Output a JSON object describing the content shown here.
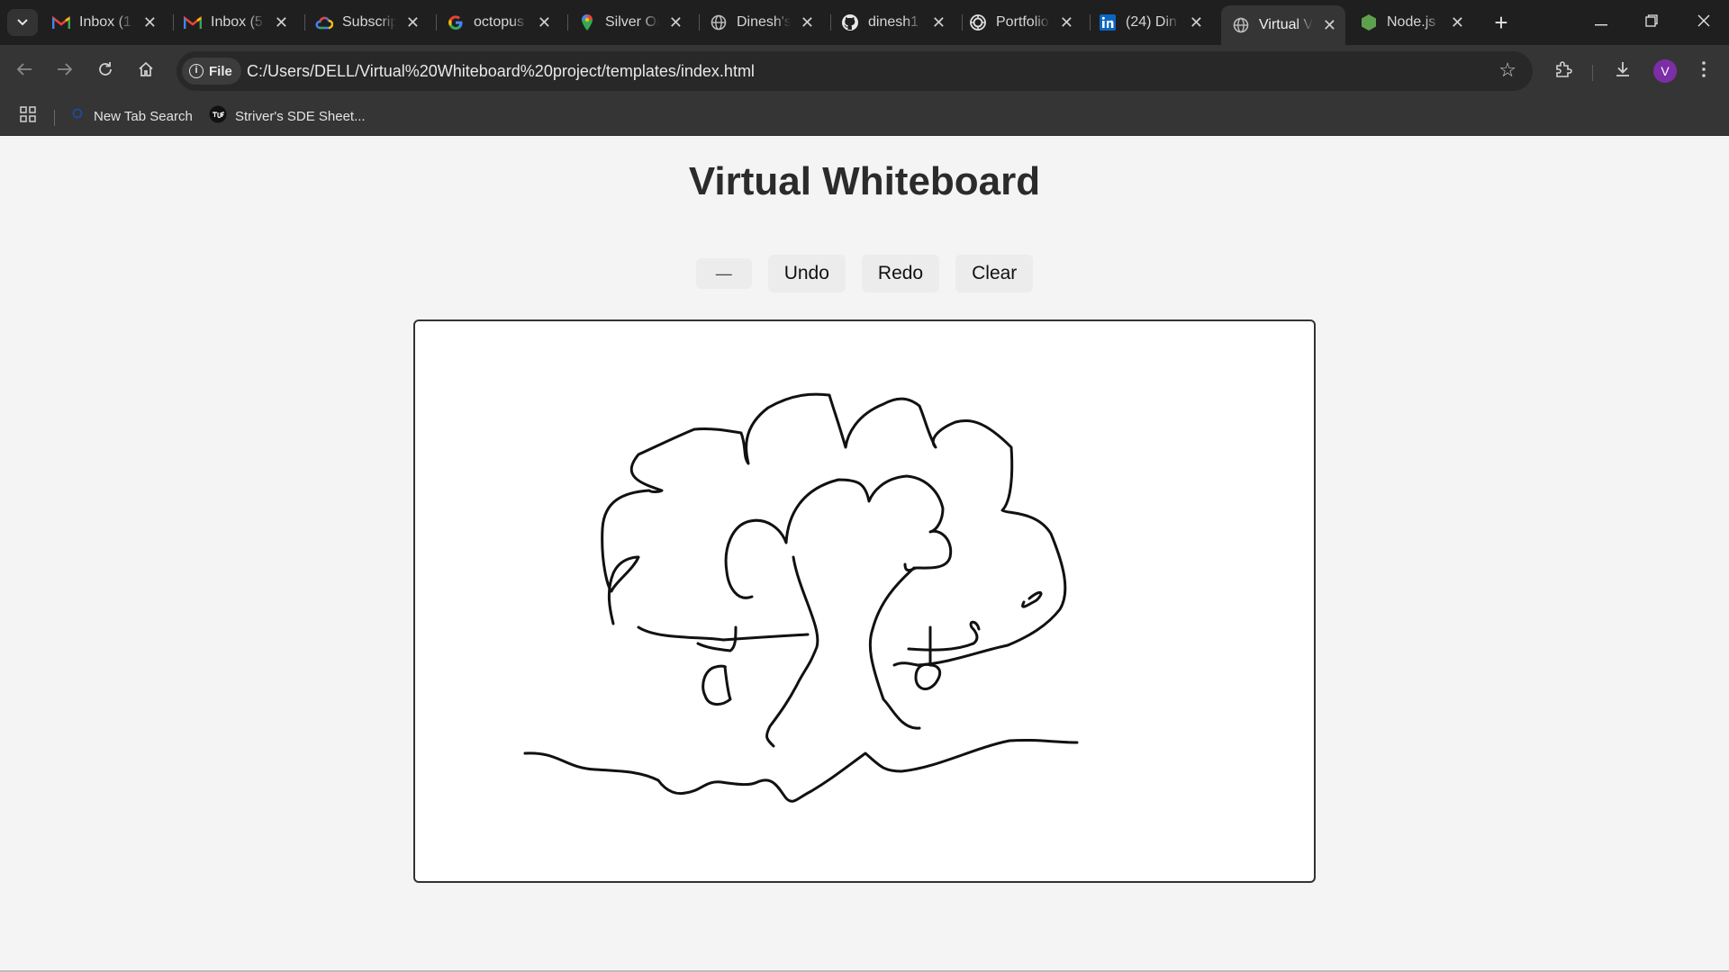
{
  "browser": {
    "tabs": [
      {
        "title": "Inbox (1",
        "icon": "gmail-icon"
      },
      {
        "title": "Inbox (5",
        "icon": "gmail-icon"
      },
      {
        "title": "Subscrip",
        "icon": "google-cloud-icon"
      },
      {
        "title": "octopus",
        "icon": "google-icon"
      },
      {
        "title": "Silver Oa",
        "icon": "maps-pin-icon"
      },
      {
        "title": "Dinesh's",
        "icon": "globe-icon"
      },
      {
        "title": "dinesh1",
        "icon": "github-icon"
      },
      {
        "title": "Portfolio",
        "icon": "openai-icon"
      },
      {
        "title": "(24) Din",
        "icon": "linkedin-icon"
      },
      {
        "title": "Virtual V",
        "icon": "globe-icon",
        "active": true
      },
      {
        "title": "Node.js",
        "icon": "nodejs-icon"
      }
    ],
    "address": {
      "chip_label": "File",
      "url": "C:/Users/DELL/Virtual%20Whiteboard%20project/templates/index.html"
    },
    "profile_initial": "V",
    "bookmarks": [
      {
        "label": "New Tab Search",
        "icon": "search-icon"
      },
      {
        "label": "Striver's SDE Sheet...",
        "icon": "tuf-logo-icon"
      }
    ]
  },
  "page": {
    "title": "Virtual Whiteboard",
    "controls": {
      "size_label": "—",
      "undo_label": "Undo",
      "redo_label": "Redo",
      "clear_label": "Clear"
    }
  },
  "colors": {
    "stroke": "#111111",
    "page_bg": "#f4f4f4",
    "canvas_bg": "#ffffff",
    "button_bg": "#ececec",
    "chrome_dark": "#1f1f1f",
    "chrome_toolbar": "#353535",
    "avatar": "#7b2ea6"
  }
}
